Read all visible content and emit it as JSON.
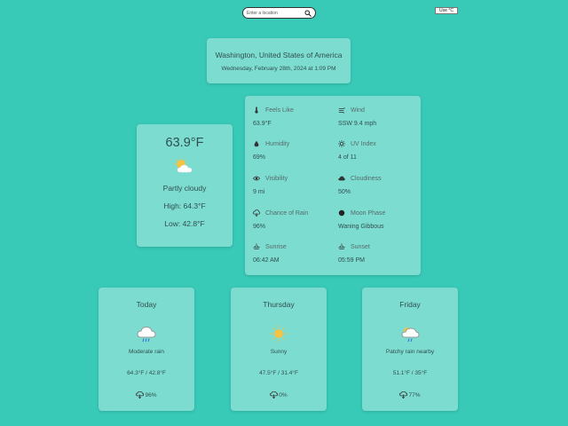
{
  "search": {
    "placeholder": "Enter a location"
  },
  "unit_toggle": {
    "label": "Use °C"
  },
  "location": {
    "name": "Washington, United States of America",
    "datetime": "Wednesday, February 28th, 2024 at 1:09 PM"
  },
  "current": {
    "temp": "63.9°F",
    "icon": "partly-cloudy-icon",
    "condition": "Partly cloudy",
    "high": "High: 64.3°F",
    "low": "Low: 42.8°F"
  },
  "details": [
    {
      "label": "Feels Like",
      "value": "63.9°F",
      "icon": "thermometer-icon"
    },
    {
      "label": "Wind",
      "value": "SSW 9.4 mph",
      "icon": "wind-icon"
    },
    {
      "label": "Humidity",
      "value": "69%",
      "icon": "droplet-icon"
    },
    {
      "label": "UV Index",
      "value": "4 of 11",
      "icon": "sun-icon"
    },
    {
      "label": "Visibility",
      "value": "9 mi",
      "icon": "eye-icon"
    },
    {
      "label": "Cloudiness",
      "value": "50%",
      "icon": "cloud-icon"
    },
    {
      "label": "Chance of Rain",
      "value": "96%",
      "icon": "rain-cloud-icon"
    },
    {
      "label": "Moon Phase",
      "value": "Waning Gibbous",
      "icon": "moon-icon"
    },
    {
      "label": "Sunrise",
      "value": "06:42 AM",
      "icon": "sunrise-icon"
    },
    {
      "label": "Sunset",
      "value": "05:59 PM",
      "icon": "sunset-icon"
    }
  ],
  "forecast": [
    {
      "day": "Today",
      "icon": "rain-cloud-icon",
      "condition": "Moderate rain",
      "range": "64.3°F / 42.8°F",
      "rain": "96%"
    },
    {
      "day": "Thursday",
      "icon": "sunny-icon",
      "condition": "Sunny",
      "range": "47.5°F / 31.4°F",
      "rain": "0%"
    },
    {
      "day": "Friday",
      "icon": "patchy-rain-icon",
      "condition": "Patchy rain nearby",
      "range": "51.1°F / 35°F",
      "rain": "77%"
    }
  ]
}
